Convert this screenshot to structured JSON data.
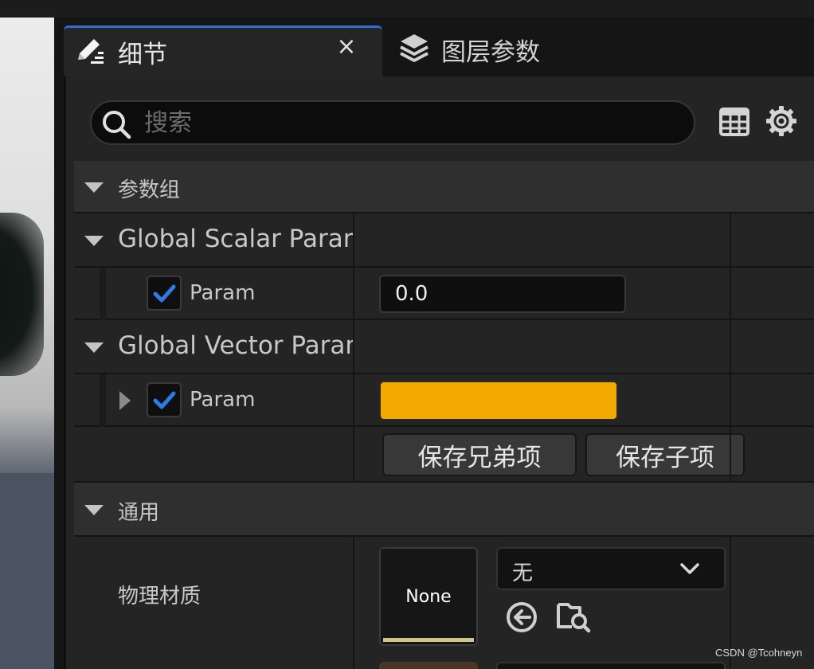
{
  "tabs": [
    {
      "label": "细节",
      "icon": "edit-details-icon",
      "active": true
    },
    {
      "label": "图层参数",
      "icon": "layers-icon",
      "active": false
    }
  ],
  "tab_close": "×",
  "search": {
    "placeholder": "搜索",
    "value": ""
  },
  "toolbar": {
    "table_icon": "table-view-icon",
    "settings_icon": "gear-icon"
  },
  "sections": {
    "params_group": "参数组",
    "scalar_group": "Global Scalar Param",
    "scalar_param": {
      "label": "Param",
      "checked": true,
      "value": "0.0"
    },
    "vector_group": "Global Vector Param",
    "vector_param": {
      "label": "Param",
      "checked": true,
      "color": "#f2a900"
    },
    "save_sibling": "保存兄弟项",
    "save_child": "保存子项",
    "general": "通用",
    "phys_material": {
      "label": "物理材质",
      "thumb": "None",
      "dropdown": "无"
    }
  },
  "colors": {
    "accent": "#2b6fd6",
    "check": "#2f7be6",
    "vector_color": "#f2a900"
  },
  "watermark": "CSDN @Tcohneyn"
}
